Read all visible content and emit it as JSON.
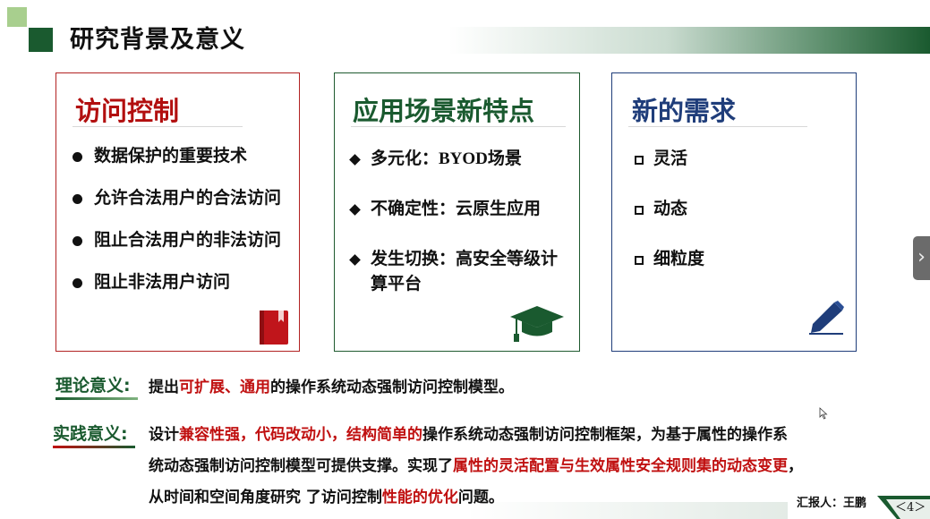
{
  "slide": {
    "title": "研究背景及意义",
    "colors": {
      "primary_green": "#1a5a2f",
      "accent_red": "#c01010",
      "navy": "#1f3d7a",
      "light_green": "#a8cf8e"
    }
  },
  "cards": [
    {
      "title": "访问控制",
      "bullet": "dot",
      "items": [
        "数据保护的重要技术",
        "允许合法用户的合法访问",
        "阻止合法用户的非法访问",
        "阻止非法用户访问"
      ],
      "icon": "book-icon"
    },
    {
      "title": "应用场景新特点",
      "bullet": "diamond",
      "items": [
        "多元化：BYOD场景",
        "不确定性：云原生应用",
        "发生切换：高安全等级计",
        "算平台"
      ],
      "icon": "graduation-cap-icon"
    },
    {
      "title": "新的需求",
      "bullet": "box",
      "items": [
        "灵活",
        "动态",
        "细粒度"
      ],
      "icon": "pen-icon"
    }
  ],
  "theory": {
    "label": "理论意义:",
    "pre": "提出",
    "highlight": "可扩展、通用",
    "post": "的操作系统动态强制访问控制模型。"
  },
  "practice": {
    "label": "实践意义:",
    "line1_pre": "设计",
    "line1_highlight": "兼容性强，代码改动小，结构简单的",
    "line1_post": "操作系统动态强制访问控制框架，为基于属性的操作系",
    "line2_pre": "统动态强制访问控制模型可提供支撑。实现了",
    "line2_highlight": "属性的灵活配置与生效属性安全规则集的动态变更",
    "line2_post": "，",
    "line3_pre": "从时间和空间角度研究 了访问控制",
    "line3_highlight": "性能的优化",
    "line3_post": "问题。"
  },
  "footer": {
    "reporter": "汇报人：王鹏",
    "page_number": "＜4＞"
  },
  "nav": {
    "next_icon": "chevron-right-icon"
  }
}
